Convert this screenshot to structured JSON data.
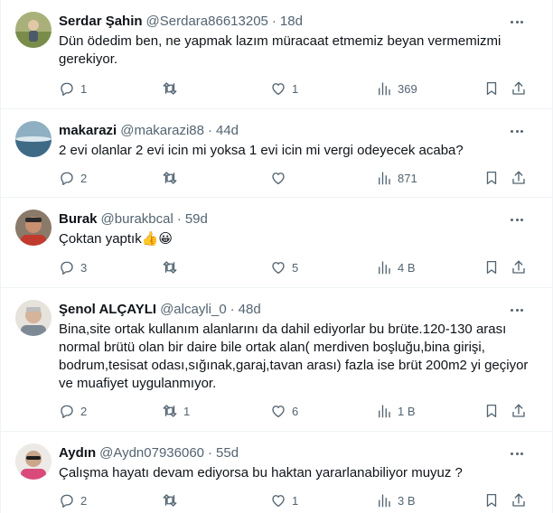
{
  "tweets": [
    {
      "name": "Serdar Şahin",
      "handle": "@Serdara86613205",
      "time": "18d",
      "text": "Dün ödedim ben, ne yapmak lazım müracaat etmemiz beyan vermemizmi gerekiyor.",
      "replies": "1",
      "retweets": "",
      "likes": "1",
      "views": "369",
      "avatar_color": "#7a8c4a"
    },
    {
      "name": "makarazi",
      "handle": "@makarazi88",
      "time": "44d",
      "text": "2 evi olanlar 2 evi icin mi yoksa 1 evi icin mi vergi odeyecek acaba?",
      "replies": "2",
      "retweets": "",
      "likes": "",
      "views": "871",
      "avatar_color": "#5f7f96"
    },
    {
      "name": "Burak",
      "handle": "@burakbcal",
      "time": "59d",
      "text": "Çoktan yaptık👍😀",
      "replies": "3",
      "retweets": "",
      "likes": "5",
      "views": "4 B",
      "avatar_color": "#6b4a3a"
    },
    {
      "name": "Şenol ALÇAYLI",
      "handle": "@alcayli_0",
      "time": "48d",
      "text": "Bina,site ortak kullanım alanlarını da dahil ediyorlar bu brüte.120-130 arası normal brütü olan bir daire bile ortak alan( merdiven boşluğu,bina girişi, bodrum,tesisat odası,sığınak,garaj,tavan arası) fazla ise brüt 200m2 yi geçiyor ve muafiyet uygulanmıyor.",
      "replies": "2",
      "retweets": "1",
      "likes": "6",
      "views": "1 B",
      "avatar_color": "#c9c1b6"
    },
    {
      "name": "Aydın",
      "handle": "@Aydn07936060",
      "time": "55d",
      "text": "Çalışma hayatı devam ediyorsa bu haktan yararlanabiliyor muyuz ?",
      "replies": "2",
      "retweets": "",
      "likes": "1",
      "views": "3 B",
      "avatar_color": "#d8d2cc"
    }
  ],
  "colors": {
    "text": "#0f1419",
    "muted": "#536471",
    "divider": "#eff3f4"
  },
  "icons": [
    "reply-icon",
    "retweet-icon",
    "like-icon",
    "views-icon",
    "bookmark-icon",
    "share-icon",
    "more-icon"
  ]
}
